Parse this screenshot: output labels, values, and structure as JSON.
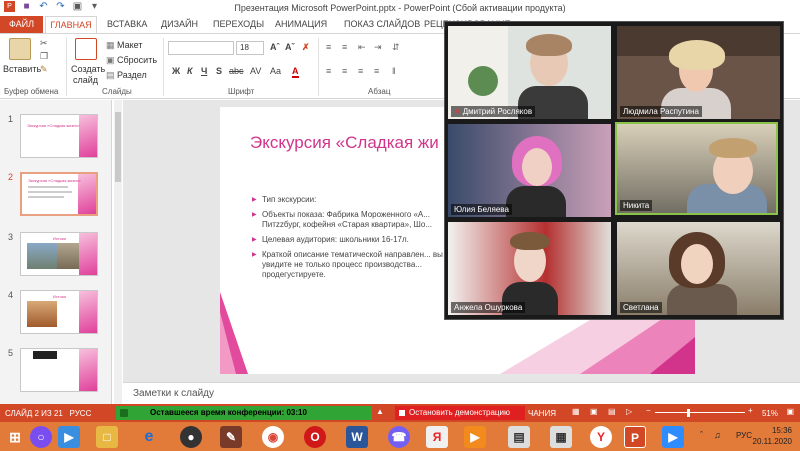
{
  "titlebar": {
    "title": "Презентация Microsoft PowerPoint.pptx - PowerPoint (Сбой активации продукта)"
  },
  "tabs": [
    "ФАЙЛ",
    "ГЛАВНАЯ",
    "ВСТАВКА",
    "ДИЗАЙН",
    "ПЕРЕХОДЫ",
    "АНИМАЦИЯ",
    "ПОКАЗ СЛАЙДОВ",
    "РЕЦЕНЗИРОВАНИЕ"
  ],
  "ribbon": {
    "paste_label": "Вставить",
    "clipboard_group": "Буфер обмена",
    "new_slide_label1": "Создать",
    "new_slide_label2": "слайд",
    "layout_label": "Макет",
    "reset_label": "Сбросить",
    "section_label": "Раздел",
    "slides_group": "Слайды",
    "font_size": "18",
    "font_group": "Шрифт",
    "paragraph_group": "Абзац",
    "format_buttons": [
      "Ж",
      "К",
      "Ч",
      "S",
      "abc",
      "AV",
      "Aa",
      "A"
    ]
  },
  "thumbnails": [
    {
      "num": "1",
      "title": "Экскурсия «Сладкая жизнь»"
    },
    {
      "num": "2",
      "title": "Экскурсия «Сладкая жизнь»"
    },
    {
      "num": "3",
      "title": "Истоки"
    },
    {
      "num": "4",
      "title": "Истоки"
    },
    {
      "num": "5",
      "title": ""
    }
  ],
  "slide": {
    "title": "Экскурсия «Сладкая жи",
    "bullets": [
      "Тип экскурсии:",
      "Объекты показа: Фабрика Мороженного «А... Питzzбург, кофейня «Старая квартира», Шо...",
      "Целевая аудитория: школьники 16-17л.",
      "Краткой описание тематической направлен... вы увидите не только процесс производства... продегустируете."
    ]
  },
  "notes": {
    "placeholder": "Заметки к слайду"
  },
  "status": {
    "slide_info": "СЛАЙД 2 ИЗ 21",
    "lang": "РУСС",
    "conference_time": "Оставшееся время конференции: 03:10",
    "stop_demo": "Остановить демонстрацию",
    "view_hint": "ЧАНИЯ",
    "zoom": "51%"
  },
  "taskbar": {
    "lang": "РУС",
    "time": "15:36",
    "date": "20.11.2020"
  },
  "participants": [
    {
      "name": "Дмитрий Росляков",
      "muted": true
    },
    {
      "name": "Людмила Распутина",
      "muted": false
    },
    {
      "name": "Юлия Беляева",
      "muted": false
    },
    {
      "name": "Никита",
      "muted": false,
      "active": true
    },
    {
      "name": "Анжела Ошуркова",
      "muted": false
    },
    {
      "name": "Светлана",
      "muted": false
    }
  ],
  "colors": {
    "accent": "#d24726",
    "slide_pink": "#d2348c",
    "conference_green": "#31a436",
    "stop_red": "#e02020"
  }
}
